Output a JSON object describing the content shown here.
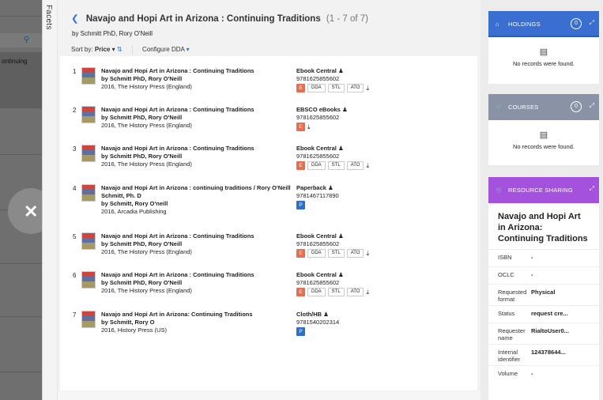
{
  "background": {
    "continuing_text": "ontinuing"
  },
  "facets_label": "Facets",
  "header": {
    "title": "Navajo and Hopi Art in Arizona : Continuing Traditions",
    "count": "(1 - 7 of 7)",
    "author": "by Schmitt PhD, Rory O'Neill"
  },
  "sort": {
    "label": "Sort by:",
    "value": "Price",
    "configure": "Configure DDA"
  },
  "results": [
    {
      "num": "1",
      "title": "Navajo and Hopi Art in Arizona : Continuing Traditions",
      "author": "by Schmitt PhD, Rory O'Neill",
      "pub": "2016, The History Press (England)",
      "source": "Ebook Central",
      "isbn": "9781625855602",
      "chips": [
        "DDA",
        "STL",
        "ATO"
      ],
      "badge": "E"
    },
    {
      "num": "2",
      "title": "Navajo and Hopi Art in Arizona : Continuing Traditions",
      "author": "by Schmitt PhD, Rory O'Neill",
      "pub": "2016, The History Press (England)",
      "source": "EBSCO eBooks",
      "isbn": "9781625855602",
      "chips": [],
      "badge": "E"
    },
    {
      "num": "3",
      "title": "Navajo and Hopi Art in Arizona : Continuing Traditions",
      "author": "by Schmitt PhD, Rory O'Neill",
      "pub": "2016, The History Press (England)",
      "source": "Ebook Central",
      "isbn": "9781625855602",
      "chips": [
        "DDA",
        "STL",
        "ATO"
      ],
      "badge": "E"
    },
    {
      "num": "4",
      "title": "Navajo and Hopi Art in Arizona : continuing traditions / Rory O'Neill",
      "title2": "Schmitt, Ph. D",
      "author": "by Schmitt, Rory O'neill",
      "pub": "2016, Arcadia Publishing",
      "source": "Paperback",
      "isbn": "9781467117890",
      "chips": [],
      "badge": "P"
    },
    {
      "num": "5",
      "title": "Navajo and Hopi Art in Arizona : Continuing Traditions",
      "author": "by Schmitt PhD, Rory O'Neill",
      "pub": "2016, The History Press (England)",
      "source": "Ebook Central",
      "isbn": "9781625855602",
      "chips": [
        "DDA",
        "STL",
        "ATO"
      ],
      "badge": "E"
    },
    {
      "num": "6",
      "title": "Navajo and Hopi Art in Arizona : Continuing Traditions",
      "author": "by Schmitt PhD, Rory O'Neill",
      "pub": "2016, The History Press (England)",
      "source": "Ebook Central",
      "isbn": "9781625855602",
      "chips": [
        "DDA",
        "STL",
        "ATO"
      ],
      "badge": "E"
    },
    {
      "num": "7",
      "title": "Navajo and Hopi Art in Arizona: Continuing Traditions",
      "author": "by Schmitt, Rory O",
      "pub": "2016, History Press (US)",
      "source": "Cloth/HB",
      "isbn": "9781540202314",
      "chips": [],
      "badge": "P"
    }
  ],
  "holdings": {
    "label": "HOLDINGS",
    "count": "0",
    "empty": "No records were found."
  },
  "courses": {
    "label": "COURSES",
    "count": "0",
    "empty": "No records were found."
  },
  "resource_sharing": {
    "label": "RESOURCE SHARING",
    "title": "Navajo and Hopi Art in Arizona: Continuing Traditions",
    "fields": [
      {
        "key": "ISBN",
        "value": "-"
      },
      {
        "key": "OCLC",
        "value": "-"
      },
      {
        "key": "Requested format",
        "value": "Physical"
      },
      {
        "key": "Status",
        "value": "request cre..."
      },
      {
        "key": "Requester name",
        "value": "RialtoUser0..."
      },
      {
        "key": "Internal identifier",
        "value": "124378644..."
      },
      {
        "key": "Volume",
        "value": "-"
      }
    ]
  },
  "colors": {
    "holdings": "#3a6ed1",
    "courses": "#8a93a5",
    "resource_sharing": "#a451dd",
    "e_badge": "#e76f51",
    "p_badge": "#2f6fc4"
  }
}
